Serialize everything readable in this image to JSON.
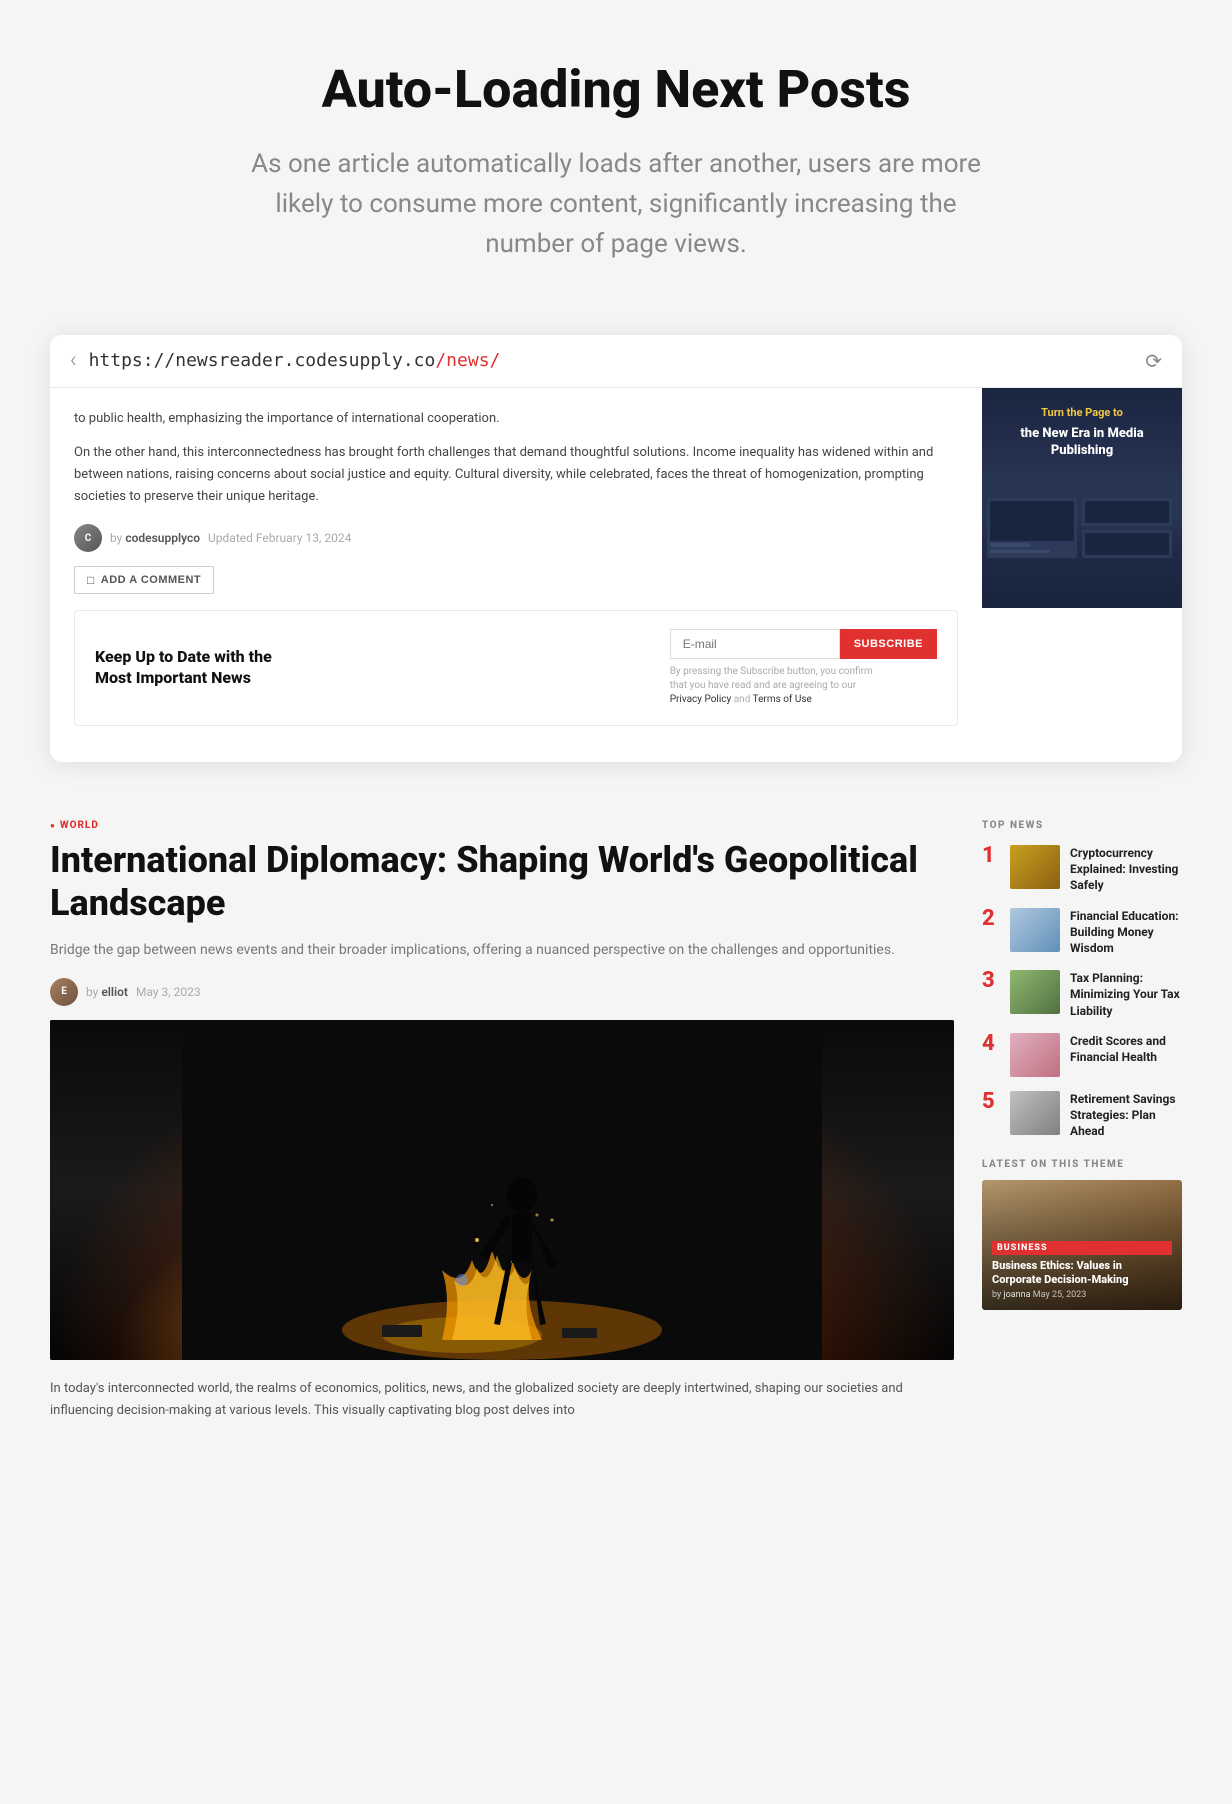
{
  "hero": {
    "title": "Auto-Loading Next Posts",
    "subtitle": "As one article automatically loads after another, users are more likely to consume more content, significantly increasing the number of page views."
  },
  "browser": {
    "url_prefix": "https://newsreader.codesupply.co",
    "url_path": "/news/"
  },
  "article_first": {
    "text1": "to public health, emphasizing the importance of international cooperation.",
    "text2": "On the other hand, this interconnectedness has brought forth challenges that demand thoughtful solutions. Income inequality has widened within and between nations, raising concerns about social justice and equity. Cultural diversity, while celebrated, faces the threat of homogenization, prompting societies to preserve their unique heritage.",
    "author": "codesupplyco",
    "date": "Updated February 13, 2024",
    "add_comment": "ADD A COMMENT"
  },
  "subscribe": {
    "title": "Keep Up to Date with the Most Important News",
    "placeholder": "E-mail",
    "button_label": "SUBSCRIBE",
    "notice": "By pressing the Subscribe button, you confirm that you have read and are agreeing to our ",
    "privacy_label": "Privacy Policy",
    "and": " and ",
    "terms_label": "Terms of Use"
  },
  "sidebar_promo": {
    "tag": "Turn the Page to",
    "title": "the New Era in Media Publishing"
  },
  "article_second": {
    "category": "WORLD",
    "title": "International Diplomacy: Shaping World's Geopolitical Landscape",
    "excerpt": "Bridge the gap between news events and their broader implications, offering a nuanced perspective on the challenges and opportunities.",
    "author": "elliot",
    "date": "May 3, 2023",
    "body": "In today's interconnected world, the realms of economics, politics, news, and the globalized society are deeply intertwined, shaping our societies and influencing decision-making at various levels. This visually captivating blog post delves into"
  },
  "top_news": {
    "label": "TOP NEWS",
    "items": [
      {
        "number": "1",
        "title": "Cryptocurrency Explained: Investing Safely",
        "thumb_class": "thumb-gold"
      },
      {
        "number": "2",
        "title": "Financial Education: Building Money Wisdom",
        "thumb_class": "thumb-blue"
      },
      {
        "number": "3",
        "title": "Tax Planning: Minimizing Your Tax Liability",
        "thumb_class": "thumb-green"
      },
      {
        "number": "4",
        "title": "Credit Scores and Financial Health",
        "thumb_class": "thumb-pink"
      },
      {
        "number": "5",
        "title": "Retirement Savings Strategies: Plan Ahead",
        "thumb_class": "thumb-gray"
      }
    ]
  },
  "latest": {
    "label": "LATEST ON THIS THEME",
    "category": "BUSINESS",
    "title": "Business Ethics: Values in Corporate Decision-Making",
    "author": "joanna",
    "date": "May 25, 2023"
  }
}
